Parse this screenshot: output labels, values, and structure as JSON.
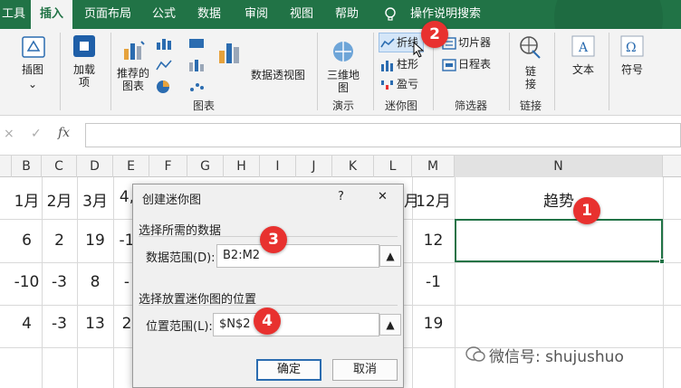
{
  "tabs": [
    "工具",
    "插入",
    "页面布局",
    "公式",
    "数据",
    "审阅",
    "视图",
    "帮助",
    "操作说明搜索"
  ],
  "ribbon": {
    "illustrations": "插图",
    "addins": "加载\n项",
    "recommended_charts": "推荐的\n图表",
    "pivot_chart": "数据透视图",
    "map3d": "三维地\n图",
    "sparkline_line": "折线",
    "sparkline_column": "柱形",
    "sparkline_winloss": "盈亏",
    "slicer": "切片器",
    "timeline": "日程表",
    "link": "链\n接",
    "text": "文本",
    "symbol": "符号",
    "groups": {
      "charts": "图表",
      "tours": "演示",
      "sparklines": "迷你图",
      "filters": "筛选器",
      "links": "链接"
    }
  },
  "formula_bar": {
    "cancel": "×",
    "enter": "✓",
    "fx": "fx"
  },
  "columns": [
    "B",
    "C",
    "D",
    "E",
    "F",
    "G",
    "H",
    "I",
    "J",
    "K",
    "L",
    "M",
    "N"
  ],
  "rows": {
    "r1": [
      "1月",
      "2月",
      "3月",
      "4,",
      "月",
      "12月",
      "趋势"
    ],
    "r2": [
      "6",
      "2",
      "19",
      "-1",
      "12"
    ],
    "r3": [
      "-10",
      "-3",
      "8",
      "-",
      "-1"
    ],
    "r4": [
      "4",
      "-3",
      "13",
      "2",
      "19"
    ]
  },
  "dialog": {
    "title": "创建迷你图",
    "help": "?",
    "close": "✕",
    "section1": "选择所需的数据",
    "data_range_label": "数据范围(D):",
    "data_range_value": "B2:M2",
    "section2": "选择放置迷你图的位置",
    "location_label": "位置范围(L):",
    "location_value": "$N$2",
    "ok": "确定",
    "cancel": "取消"
  },
  "callouts": [
    "1",
    "2",
    "3",
    "4"
  ],
  "watermark": "微信号: shujushuo",
  "colors": {
    "excel_green": "#217346",
    "callout_red": "#e8312f"
  }
}
